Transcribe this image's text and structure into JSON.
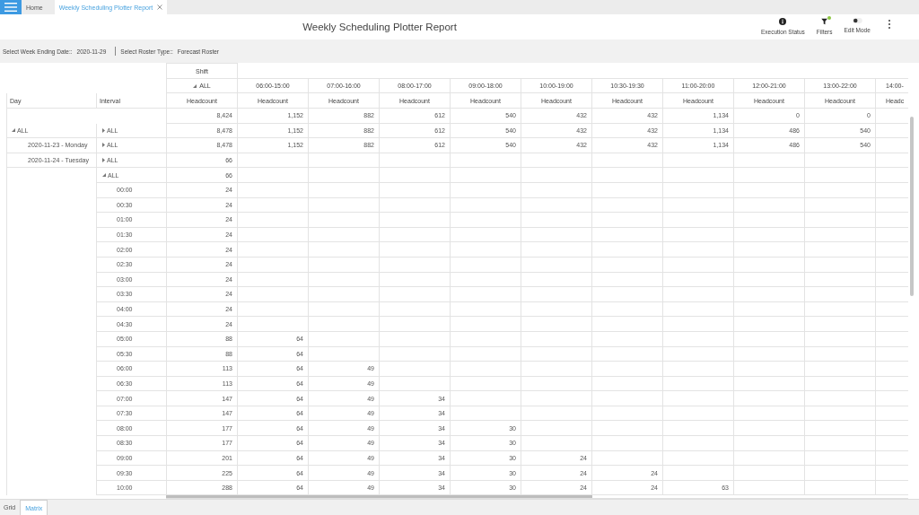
{
  "tabs": [
    {
      "label": "Home",
      "selected": false,
      "closable": false
    },
    {
      "label": "Weekly Scheduling Plotter Report",
      "selected": true,
      "closable": true
    }
  ],
  "header": {
    "title": "Weekly Scheduling Plotter Report",
    "actions": [
      {
        "kind": "status",
        "label": "Execution Status"
      },
      {
        "kind": "filter",
        "label": "Filters",
        "active": true
      },
      {
        "kind": "toggle",
        "label": "Edit Mode",
        "on": false
      }
    ]
  },
  "filters": [
    {
      "label": "Select Week Ending Date::",
      "value": "2020-11-29"
    },
    {
      "label": "Select Roster Type::",
      "value": "Forecast Roster"
    }
  ],
  "matrix": {
    "shift_header": "Shift",
    "row_headers": [
      "Day",
      "Interval"
    ],
    "columns": [
      {
        "label": "ALL",
        "expanded": true,
        "measure": "Headcount"
      },
      {
        "label": "06:00-15:00",
        "measure": "Headcount"
      },
      {
        "label": "07:00-16:00",
        "measure": "Headcount"
      },
      {
        "label": "08:00-17:00",
        "measure": "Headcount"
      },
      {
        "label": "09:00-18:00",
        "measure": "Headcount"
      },
      {
        "label": "10:00-19:00",
        "measure": "Headcount"
      },
      {
        "label": "10:30-19:30",
        "measure": "Headcount"
      },
      {
        "label": "11:00-20:00",
        "measure": "Headcount"
      },
      {
        "label": "12:00-21:00",
        "measure": "Headcount"
      },
      {
        "label": "13:00-22:00",
        "measure": "Headcount"
      },
      {
        "label": "14:00-",
        "measure": "Headc"
      }
    ],
    "grand_total": {
      "values": [
        "8,424",
        "1,152",
        "882",
        "612",
        "540",
        "432",
        "432",
        "1,134",
        "0",
        "0"
      ]
    },
    "days": [
      {
        "label": "ALL",
        "expanded": true,
        "intervals": [
          {
            "label": "ALL",
            "expanded": false,
            "values": [
              "8,478",
              "1,152",
              "882",
              "612",
              "540",
              "432",
              "432",
              "1,134",
              "486",
              "540"
            ]
          }
        ],
        "children": [
          {
            "label": "2020-11-23 - Monday",
            "intervals": [
              {
                "label": "ALL",
                "expanded": false,
                "values": [
                  "8,478",
                  "1,152",
                  "882",
                  "612",
                  "540",
                  "432",
                  "432",
                  "1,134",
                  "486",
                  "540"
                ]
              }
            ]
          },
          {
            "label": "2020-11-24 - Tuesday",
            "intervals": [
              {
                "label": "ALL",
                "expanded": false,
                "values": [
                  "66"
                ]
              },
              {
                "label": "ALL",
                "expanded": true,
                "values": [
                  "66"
                ],
                "children": [
                  {
                    "label": "00:00",
                    "values": [
                      "24"
                    ]
                  },
                  {
                    "label": "00:30",
                    "values": [
                      "24"
                    ]
                  },
                  {
                    "label": "01:00",
                    "values": [
                      "24"
                    ]
                  },
                  {
                    "label": "01:30",
                    "values": [
                      "24"
                    ]
                  },
                  {
                    "label": "02:00",
                    "values": [
                      "24"
                    ]
                  },
                  {
                    "label": "02:30",
                    "values": [
                      "24"
                    ]
                  },
                  {
                    "label": "03:00",
                    "values": [
                      "24"
                    ]
                  },
                  {
                    "label": "03:30",
                    "values": [
                      "24"
                    ]
                  },
                  {
                    "label": "04:00",
                    "values": [
                      "24"
                    ]
                  },
                  {
                    "label": "04:30",
                    "values": [
                      "24"
                    ]
                  },
                  {
                    "label": "05:00",
                    "values": [
                      "88",
                      "64"
                    ]
                  },
                  {
                    "label": "05:30",
                    "values": [
                      "88",
                      "64"
                    ]
                  },
                  {
                    "label": "06:00",
                    "values": [
                      "113",
                      "64",
                      "49"
                    ]
                  },
                  {
                    "label": "06:30",
                    "values": [
                      "113",
                      "64",
                      "49"
                    ]
                  },
                  {
                    "label": "07:00",
                    "values": [
                      "147",
                      "64",
                      "49",
                      "34"
                    ]
                  },
                  {
                    "label": "07:30",
                    "values": [
                      "147",
                      "64",
                      "49",
                      "34"
                    ]
                  },
                  {
                    "label": "08:00",
                    "values": [
                      "177",
                      "64",
                      "49",
                      "34",
                      "30"
                    ]
                  },
                  {
                    "label": "08:30",
                    "values": [
                      "177",
                      "64",
                      "49",
                      "34",
                      "30"
                    ]
                  },
                  {
                    "label": "09:00",
                    "values": [
                      "201",
                      "64",
                      "49",
                      "34",
                      "30",
                      "24"
                    ]
                  },
                  {
                    "label": "09:30",
                    "values": [
                      "225",
                      "64",
                      "49",
                      "34",
                      "30",
                      "24",
                      "24"
                    ]
                  },
                  {
                    "label": "10:00",
                    "values": [
                      "288",
                      "64",
                      "49",
                      "34",
                      "30",
                      "24",
                      "24",
                      "63"
                    ]
                  }
                ]
              }
            ]
          }
        ]
      }
    ]
  },
  "view_tabs": [
    {
      "label": "Grid",
      "selected": false
    },
    {
      "label": "Matrix",
      "selected": true
    }
  ]
}
